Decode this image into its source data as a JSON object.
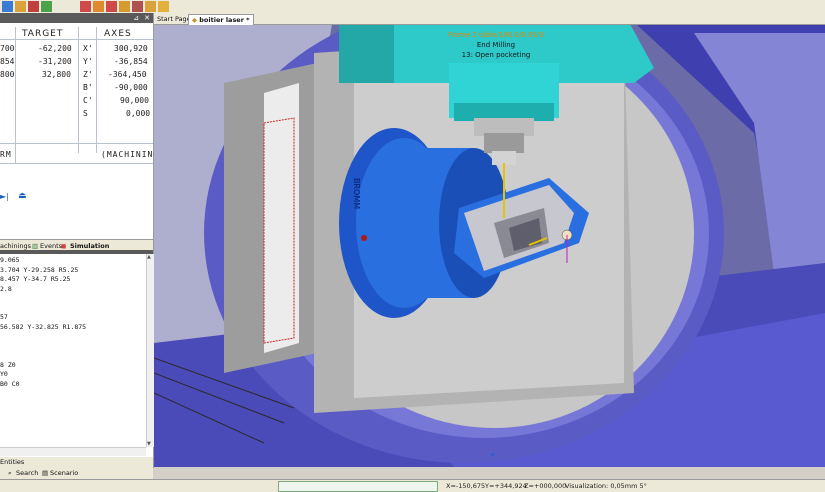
{
  "doc_tabs": {
    "start_page": "Start Page",
    "active_doc": "boitier laser *"
  },
  "position_panel": {
    "headers": {
      "target": "TARGET",
      "axes": "AXES"
    },
    "left_values": [
      "700",
      "854",
      "800"
    ],
    "target_values": [
      "-62,200",
      "-31,200",
      "32,800"
    ],
    "axis_names": [
      "X'",
      "Y'",
      "Z'",
      "B'",
      "C'",
      "S"
    ],
    "axis_values": [
      "300,920",
      "-36,854",
      "-364,450",
      "-90,000",
      "90,000",
      "0,000"
    ],
    "mode_left": "RM",
    "mode_right": "(MACHINING)"
  },
  "bottom_tabs": {
    "machinings": "achinings",
    "events": "Events",
    "simulation": "Simulation"
  },
  "code_lines": [
    "9.065",
    "3.704 Y-29.258 R5.25",
    "8.457 Y-34.7 R5.25",
    "2.8",
    "",
    "",
    "57",
    "56.582 Y-32.825 R1.875",
    "",
    "",
    "",
    "8 Z0",
    "Y0",
    "B0 C0"
  ],
  "panel_tabs": {
    "entities": "Entities",
    "search": "Search",
    "scenario": "Scenario"
  },
  "overlay": {
    "line1": "Frame 2 table/180.0/0.05/0",
    "line2": "End Milling",
    "line3": "13: Open pocketing"
  },
  "spindle_label": "BROMM",
  "status": {
    "x": "X=-150,675",
    "y": "Y=+344,924",
    "z": "Z=+000,000",
    "visualization": "Visualization: 0,05mm 5°"
  },
  "colors": {
    "machine_blue": "#5656c8",
    "spindle_cyan": "#2ec9c9",
    "rotary_blue": "#2a6fe0",
    "toolpath_red": "#cc2222"
  }
}
